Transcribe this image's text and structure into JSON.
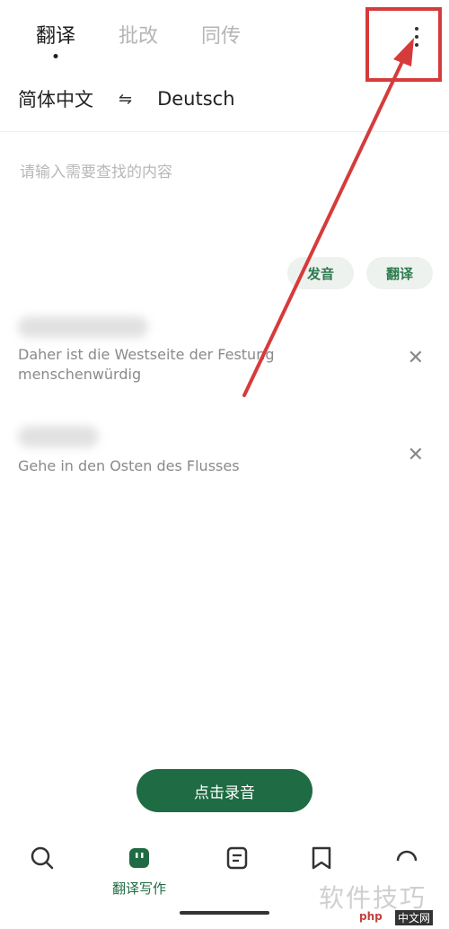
{
  "tabs": [
    {
      "label": "翻译",
      "active": true
    },
    {
      "label": "批改",
      "active": false
    },
    {
      "label": "同传",
      "active": false
    }
  ],
  "language": {
    "source": "简体中文",
    "target": "Deutsch",
    "swap_icon": "swap-icon"
  },
  "search": {
    "placeholder": "请输入需要查找的内容",
    "value": ""
  },
  "actions": {
    "speak_label": "发音",
    "translate_label": "翻译"
  },
  "history": [
    {
      "translation": "Daher ist die Westseite der Festung menschenwürdig"
    },
    {
      "translation": "Gehe in den Osten des Flusses"
    }
  ],
  "record": {
    "label": "点击录音"
  },
  "bottom_nav": {
    "active_label": "翻译写作"
  },
  "watermark": {
    "text": "软件技巧",
    "site_a": "php",
    "site_b": "中文网"
  },
  "colors": {
    "accent": "#1f6b43",
    "annotation": "#d63b3b"
  }
}
